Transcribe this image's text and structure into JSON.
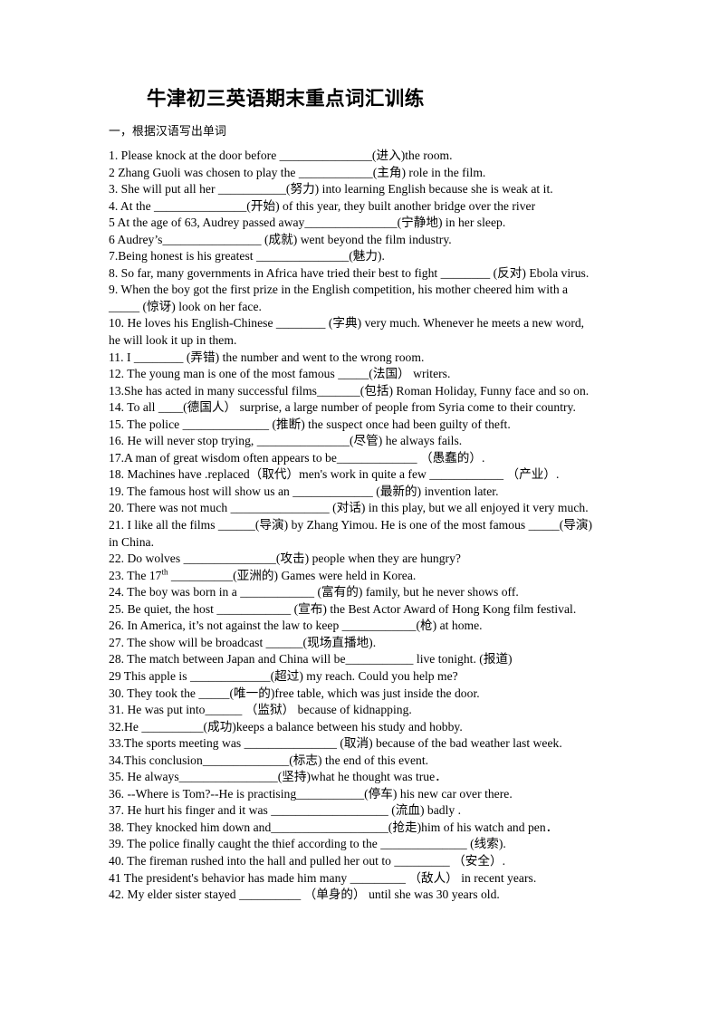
{
  "document": {
    "title": "牛津初三英语期末重点词汇训练",
    "section_heading": "一，根据汉语写出单词",
    "questions": [
      "1. Please knock at the door before _______________(进入)the room.",
      "2 Zhang Guoli was chosen to play the ____________(主角) role in the film.",
      "3. She will put all her ___________(努力) into learning English because she is weak at it.",
      "4. At the _______________(开始) of this year, they built another bridge over the river",
      "5 At the age of 63, Audrey passed away_______________(宁静地) in her sleep.",
      "6 Audrey’s________________ (成就) went beyond the film industry.",
      "7.Being honest is his greatest _______________(魅力).",
      "8. So far, many governments in Africa have tried their best to fight ________ (反对) Ebola virus.",
      "9. When the boy got the first prize in the English competition, his mother cheered him with a",
      "_____ (惊讶) look on her face.",
      "10. He loves his English-Chinese ________ (字典) very much. Whenever he meets a new word,",
      "he will look it up in them.",
      "11. I ________ (弄错) the number and went to the wrong room.",
      "12. The young man is one of the most famous _____(法国） writers.",
      "13.She has acted in many successful films_______(包括) Roman Holiday, Funny face and so on.",
      "14. To all ____(德国人） surprise, a large number of people from Syria come to their country.",
      "15. The police ______________ (推断) the suspect once had been guilty of theft.",
      "16. He will never stop trying, _______________(尽管) he always fails.",
      "17.A man of great wisdom often appears to be_____________ （愚蠢的）.",
      "18. Machines have .replaced（取代）men's work in quite a few ____________ （产业）.",
      "19. The famous host will show us an _____________ (最新的) invention later.",
      "20. There was not much ________________ (对话) in this play, but we all enjoyed it very much.",
      "21. I like all the films ______(导演) by Zhang Yimou. He is one of the most famous _____(导演)",
      "in China.",
      "22. Do wolves _______________(攻击) people when they are hungry?",
      "23. The 17<sup>th</sup> __________(亚洲的) Games were held in Korea.",
      "24. The boy was born in a ____________ (富有的) family, but he never shows off.",
      "25. Be quiet, the host ____________ (宣布) the Best Actor Award of Hong Kong film festival.",
      "26. In America, it’s not against the law to keep ____________(枪) at home.",
      "27. The show will be broadcast ______(现场直播地).",
      "28. The match between Japan and China will be___________ live tonight. (报道)",
      "29 This apple is _____________(超过) my reach. Could you help me?",
      "30. They took the _____(唯一的)free table, which was just inside the door.",
      "31. He was put into______ （监狱） because of kidnapping.",
      "32.He __________(成功)keeps a balance between his study and hobby.",
      "33.The sports meeting was _______________ (取消) because of the bad weather last week.",
      "34.This conclusion______________(标志) the end of this event.",
      "35. He always________________(坚持)what he thought was true．",
      "36. --Where is Tom?--He is practising___________(停车) his new car over there.",
      "37. He hurt his finger and it was ___________________ (流血) badly .",
      "38. They knocked him down and___________________(抢走)him of his watch and pen．",
      "39. The police finally caught the thief according to the ______________ (线索).",
      "40. The fireman rushed into the hall and pulled her out to _________ （安全）.",
      "41 The president's behavior has made him many _________ （敌人） in recent years.",
      "42. My elder sister stayed __________ （单身的） until she was 30 years old."
    ]
  }
}
